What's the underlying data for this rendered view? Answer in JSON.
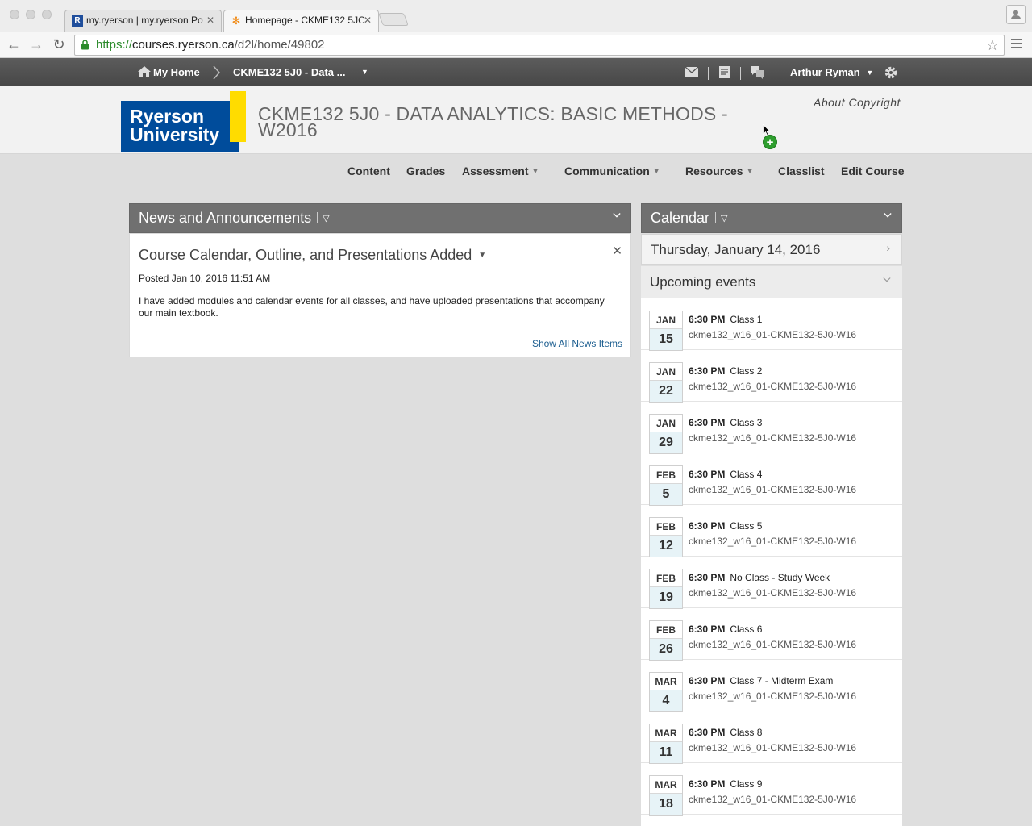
{
  "browser": {
    "tabs": [
      {
        "favicon": "R",
        "title": "my.ryerson | my.ryerson Po"
      },
      {
        "favicon": "✻",
        "title": "Homepage - CKME132 5JC"
      }
    ],
    "url_scheme": "https://",
    "url_host": "courses.ryerson.ca",
    "url_path": "/d2l/home/49802"
  },
  "navbar": {
    "home_label": "My Home",
    "course_label": "CKME132 5J0 - Data ...",
    "user_name": "Arthur Ryman"
  },
  "header": {
    "logo_line1": "Ryerson",
    "logo_line2": "University",
    "course_title": "CKME132 5J0 - DATA ANALYTICS: BASIC METHODS - W2016",
    "about_copyright": "About Copyright"
  },
  "course_nav": {
    "content": "Content",
    "grades": "Grades",
    "assessment": "Assessment",
    "communication": "Communication",
    "resources": "Resources",
    "classlist": "Classlist",
    "edit_course": "Edit Course"
  },
  "news": {
    "widget_title": "News and Announcements",
    "item_title": "Course Calendar, Outline, and Presentations Added",
    "posted": "Posted Jan 10, 2016 11:51 AM",
    "body": "I have added modules and calendar events for all classes, and have uploaded presentations that accompany our main textbook.",
    "show_all": "Show All News Items"
  },
  "calendar": {
    "widget_title": "Calendar",
    "current_date": "Thursday, January 14, 2016",
    "upcoming_label": "Upcoming events",
    "events": [
      {
        "month": "JAN",
        "day": "15",
        "time": "6:30 PM",
        "title": "Class 1",
        "course": "ckme132_w16_01-CKME132-5J0-W16"
      },
      {
        "month": "JAN",
        "day": "22",
        "time": "6:30 PM",
        "title": "Class 2",
        "course": "ckme132_w16_01-CKME132-5J0-W16"
      },
      {
        "month": "JAN",
        "day": "29",
        "time": "6:30 PM",
        "title": "Class 3",
        "course": "ckme132_w16_01-CKME132-5J0-W16"
      },
      {
        "month": "FEB",
        "day": "5",
        "time": "6:30 PM",
        "title": "Class 4",
        "course": "ckme132_w16_01-CKME132-5J0-W16"
      },
      {
        "month": "FEB",
        "day": "12",
        "time": "6:30 PM",
        "title": "Class 5",
        "course": "ckme132_w16_01-CKME132-5J0-W16"
      },
      {
        "month": "FEB",
        "day": "19",
        "time": "6:30 PM",
        "title": "No Class - Study Week",
        "course": "ckme132_w16_01-CKME132-5J0-W16"
      },
      {
        "month": "FEB",
        "day": "26",
        "time": "6:30 PM",
        "title": "Class 6",
        "course": "ckme132_w16_01-CKME132-5J0-W16"
      },
      {
        "month": "MAR",
        "day": "4",
        "time": "6:30 PM",
        "title": "Class 7 - Midterm Exam",
        "course": "ckme132_w16_01-CKME132-5J0-W16"
      },
      {
        "month": "MAR",
        "day": "11",
        "time": "6:30 PM",
        "title": "Class 8",
        "course": "ckme132_w16_01-CKME132-5J0-W16"
      },
      {
        "month": "MAR",
        "day": "18",
        "time": "6:30 PM",
        "title": "Class 9",
        "course": "ckme132_w16_01-CKME132-5J0-W16"
      }
    ]
  },
  "colors": {
    "ryerson_blue": "#004c9b",
    "ryerson_yellow": "#ffdc00",
    "navbar_gray": "#4f4f4f",
    "widget_header": "#707070",
    "link_blue": "#1b5d8f"
  },
  "icons": [
    "home-icon",
    "chevron-right-icon",
    "mail-icon",
    "checklist-icon",
    "chat-icon",
    "gear-icon",
    "close-icon",
    "chevron-down-icon",
    "lock-icon",
    "star-icon",
    "menu-icon",
    "user-icon"
  ]
}
